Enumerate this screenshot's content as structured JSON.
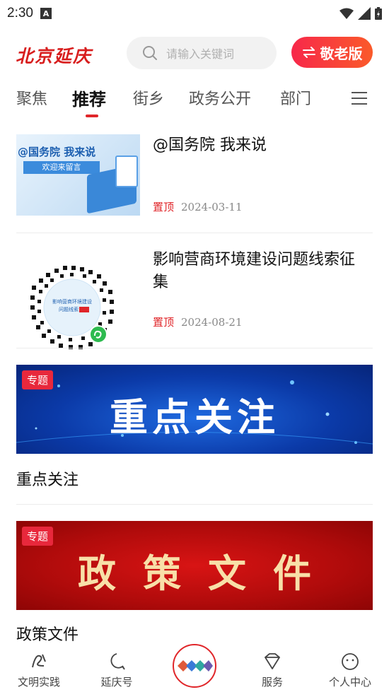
{
  "status_bar": {
    "time": "2:30"
  },
  "header": {
    "logo_text": "北京延庆",
    "search_placeholder": "请输入关键词",
    "elder_mode_label": "敬老版"
  },
  "tabs": [
    {
      "label": "聚焦",
      "active": false
    },
    {
      "label": "推荐",
      "active": true
    },
    {
      "label": "街乡",
      "active": false
    },
    {
      "label": "政务公开",
      "active": false
    },
    {
      "label": "部门",
      "active": false
    }
  ],
  "articles": [
    {
      "title": "@国务院  我来说",
      "tag": "置顶",
      "date": "2024-03-11",
      "thumb_title": "@国务院 我来说",
      "thumb_sub": "欢迎来留言"
    },
    {
      "title": "影响营商环境建设问题线索征集",
      "tag": "置顶",
      "date": "2024-08-21",
      "thumb_label": "影响营商环境建设问题线索征集"
    }
  ],
  "banners": [
    {
      "badge": "专题",
      "text": "重点关注",
      "caption": "重点关注"
    },
    {
      "badge": "专题",
      "text": "政策文件",
      "caption": "政策文件"
    }
  ],
  "bottom_nav": [
    {
      "label": "文明实践",
      "icon": "civilization-logo-icon"
    },
    {
      "label": "延庆号",
      "icon": "chat-bubble-icon"
    },
    {
      "label": "",
      "icon": "home-logo-icon"
    },
    {
      "label": "服务",
      "icon": "diamond-icon"
    },
    {
      "label": "个人中心",
      "icon": "smiley-face-icon"
    }
  ],
  "colors": {
    "accent": "#e0262a",
    "logo": "#d81e1e",
    "banner_blue": "#0b3aa8",
    "banner_red": "#b00b0b"
  }
}
